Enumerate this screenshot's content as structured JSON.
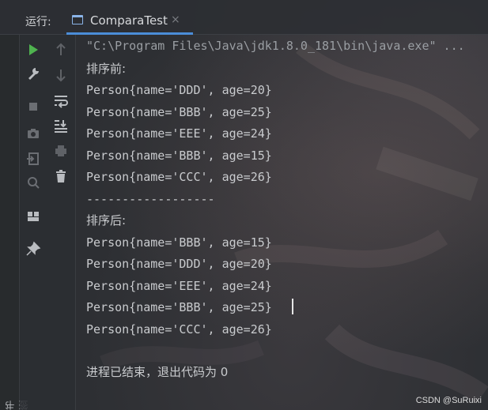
{
  "run_panel": {
    "label": "运行:",
    "tab": {
      "title": "ComparaTest",
      "icon": "console-tab-icon",
      "close": "×"
    }
  },
  "left_bar": {
    "bookmarks_label": "书签"
  },
  "toolbar": {
    "col1": [
      "run-icon",
      "wrench-icon",
      "stop-icon",
      "camera-icon",
      "login-icon",
      "zoom-icon",
      "layout-icon",
      "pin-icon"
    ],
    "col2": [
      "arrow-up-icon",
      "arrow-down-icon",
      "soft-wrap-icon",
      "scroll-to-end-icon",
      "print-icon",
      "trash-icon"
    ]
  },
  "console": {
    "command": "\"C:\\Program Files\\Java\\jdk1.8.0_181\\bin\\java.exe\" ...",
    "before_label": "排序前:",
    "before": [
      "Person{name='DDD', age=20}",
      "Person{name='BBB', age=25}",
      "Person{name='EEE', age=24}",
      "Person{name='BBB', age=15}",
      "Person{name='CCC', age=26}"
    ],
    "separator": "------------------",
    "after_label": "排序后:",
    "after": [
      "Person{name='BBB', age=15}",
      "Person{name='DDD', age=20}",
      "Person{name='EEE', age=24}",
      "Person{name='BBB', age=25}",
      "Person{name='CCC', age=26}"
    ],
    "exit_message": "进程已结束，退出代码为 0"
  },
  "watermark": "CSDN @SuRuixi",
  "colors": {
    "accent": "#4b8dd8",
    "run_green": "#4fb34f",
    "text": "#c9cbce"
  }
}
